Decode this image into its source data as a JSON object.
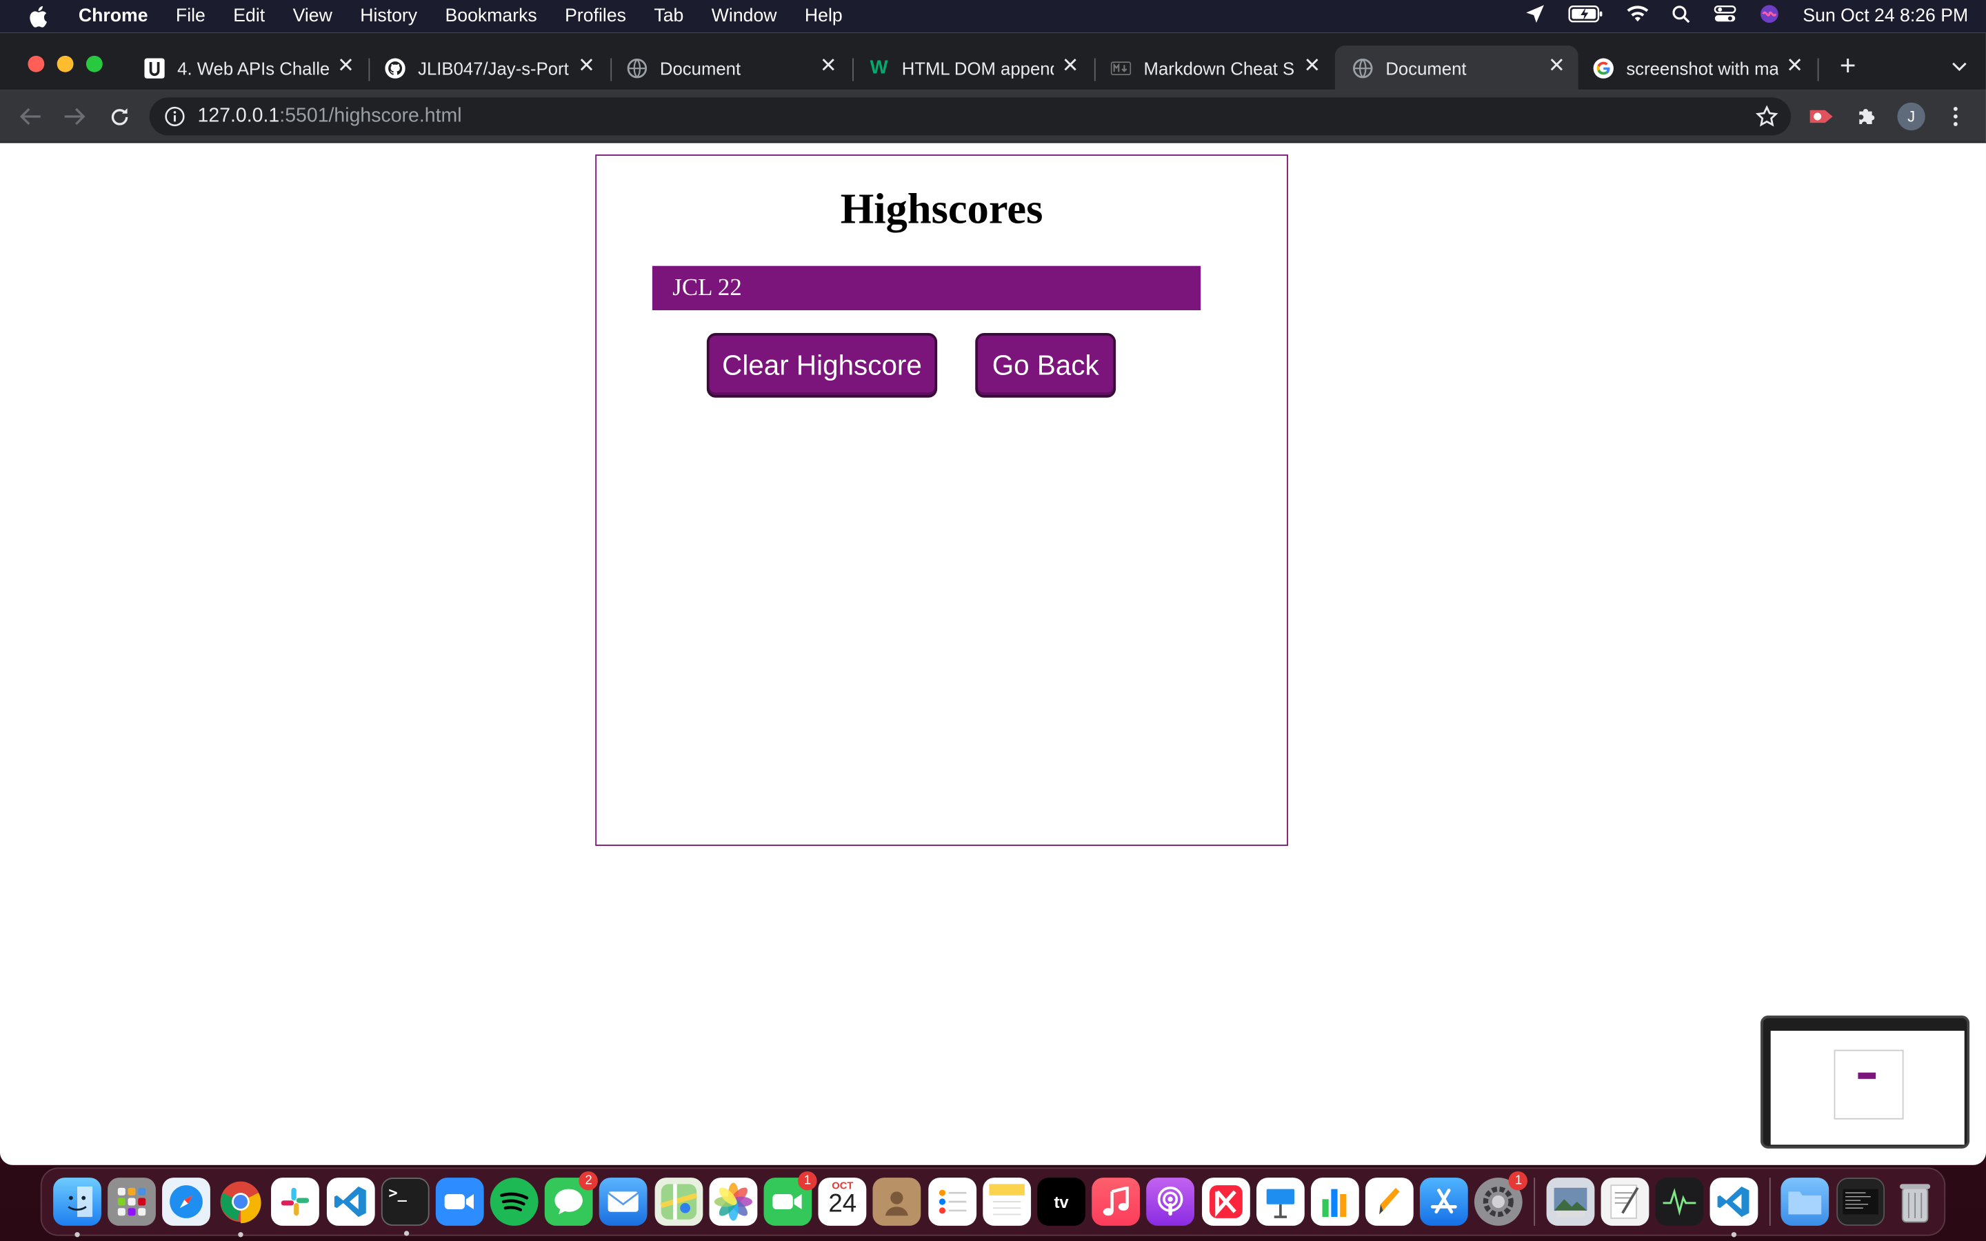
{
  "menubar": {
    "app": "Chrome",
    "items": [
      "File",
      "Edit",
      "View",
      "History",
      "Bookmarks",
      "Profiles",
      "Tab",
      "Window",
      "Help"
    ],
    "clock": "Sun Oct 24  8:26 PM"
  },
  "tabs": [
    {
      "title": "4. Web APIs Challe",
      "icon": "university-icon"
    },
    {
      "title": "JLIB047/Jay-s-Port",
      "icon": "github-icon"
    },
    {
      "title": "Document",
      "icon": "globe-icon"
    },
    {
      "title": "HTML DOM append",
      "icon": "w3schools-icon"
    },
    {
      "title": "Markdown Cheat Sh",
      "icon": "markdown-icon"
    },
    {
      "title": "Document",
      "icon": "globe-icon",
      "active": true
    },
    {
      "title": "screenshot with ma",
      "icon": "google-icon"
    }
  ],
  "omnibox": {
    "host": "127.0.0.1",
    "path": ":5501/highscore.html"
  },
  "page": {
    "heading": "Highscores",
    "scores": [
      "JCL 22"
    ],
    "clear_button": "Clear Highscore",
    "back_button": "Go Back"
  },
  "colors": {
    "accent": "#7b147b"
  },
  "profile_initial": "J",
  "dock": {
    "calendar_month": "OCT",
    "calendar_day": "24",
    "messages_badge": "2",
    "facetime_badge": "1",
    "settings_badge": "1"
  }
}
